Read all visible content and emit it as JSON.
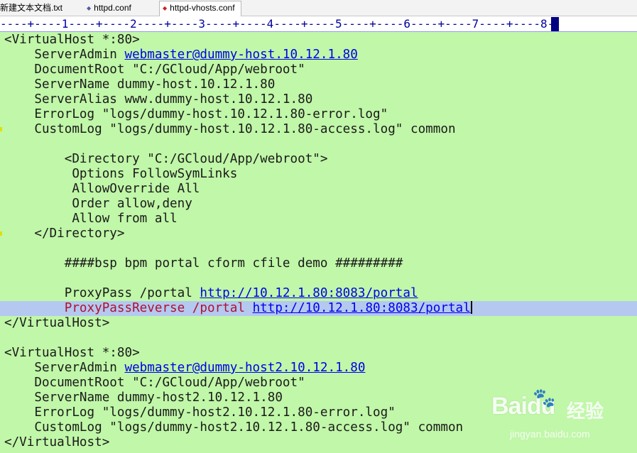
{
  "tabs": [
    {
      "label": "新建文本文档.txt",
      "active": false
    },
    {
      "label": "httpd.conf",
      "active": false
    },
    {
      "label": "httpd-vhosts.conf",
      "active": true
    }
  ],
  "ruler": "----+----1----+----2----+----3----+----4----+----5----+----6----+----7----+----8--",
  "editor": {
    "colors": {
      "background": "#c0f7a8",
      "current_line": "#b4c8f0",
      "link": "#0000e8",
      "keyword_red": "#b01030"
    },
    "lines": [
      {
        "segments": [
          {
            "text": "<VirtualHost *:80>"
          }
        ]
      },
      {
        "segments": [
          {
            "text": "    ServerAdmin "
          },
          {
            "text": "webmaster@dummy-host.10.12.1.80",
            "link": true
          }
        ]
      },
      {
        "segments": [
          {
            "text": "    DocumentRoot \"C:/GCloud/App/webroot\""
          }
        ]
      },
      {
        "segments": [
          {
            "text": "    ServerName dummy-host.10.12.1.80"
          }
        ]
      },
      {
        "segments": [
          {
            "text": "    ServerAlias www.dummy-host.10.12.1.80"
          }
        ]
      },
      {
        "segments": [
          {
            "text": "    ErrorLog \"logs/dummy-host.10.12.1.80-error.log\""
          }
        ]
      },
      {
        "segments": [
          {
            "text": "    CustomLog \"logs/dummy-host.10.12.1.80-access.log\" common"
          }
        ]
      },
      {
        "segments": [
          {
            "text": ""
          }
        ]
      },
      {
        "segments": [
          {
            "text": "        <Directory \"C:/GCloud/App/webroot\">"
          }
        ]
      },
      {
        "segments": [
          {
            "text": "         Options FollowSymLinks"
          }
        ]
      },
      {
        "segments": [
          {
            "text": "         AllowOverride All"
          }
        ]
      },
      {
        "segments": [
          {
            "text": "         Order allow,deny"
          }
        ]
      },
      {
        "segments": [
          {
            "text": "         Allow from all"
          }
        ]
      },
      {
        "segments": [
          {
            "text": "    </Directory>"
          }
        ]
      },
      {
        "segments": [
          {
            "text": ""
          }
        ]
      },
      {
        "segments": [
          {
            "text": "        ####bsp bpm portal cform cfile demo #########"
          }
        ]
      },
      {
        "segments": [
          {
            "text": ""
          }
        ]
      },
      {
        "segments": [
          {
            "text": "        ProxyPass /portal "
          },
          {
            "text": "http://10.12.1.80:8083/portal",
            "link": true
          }
        ]
      },
      {
        "current": true,
        "segments": [
          {
            "text": "        ProxyPassReverse /portal ",
            "red": true
          },
          {
            "text": "http://10.12.1.80:8083/portal",
            "link": true
          }
        ]
      },
      {
        "segments": [
          {
            "text": "</VirtualHost>"
          }
        ]
      },
      {
        "segments": [
          {
            "text": ""
          }
        ]
      },
      {
        "segments": [
          {
            "text": "<VirtualHost *:80>"
          }
        ]
      },
      {
        "segments": [
          {
            "text": "    ServerAdmin "
          },
          {
            "text": "webmaster@dummy-host2.10.12.1.80",
            "link": true
          }
        ]
      },
      {
        "segments": [
          {
            "text": "    DocumentRoot \"C:/GCloud/App/webroot\""
          }
        ]
      },
      {
        "segments": [
          {
            "text": "    ServerName dummy-host2.10.12.1.80"
          }
        ]
      },
      {
        "segments": [
          {
            "text": "    ErrorLog \"logs/dummy-host2.10.12.1.80-error.log\""
          }
        ]
      },
      {
        "segments": [
          {
            "text": "    CustomLog \"logs/dummy-host2.10.12.1.80-access.log\" common"
          }
        ]
      },
      {
        "segments": [
          {
            "text": "</VirtualHost>"
          }
        ]
      }
    ]
  },
  "watermark": {
    "logo": "Baidu",
    "brand_cn": "经验",
    "url": "jingyan.baidu.com"
  }
}
